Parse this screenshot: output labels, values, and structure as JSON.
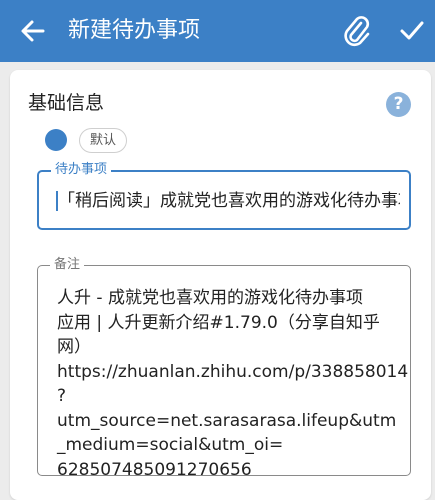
{
  "appbar": {
    "title": "新建待办事项",
    "color": "#3c80c6"
  },
  "form": {
    "section_title": "基础信息",
    "help_icon_glyph": "?",
    "color_dot": "#3c80c6",
    "category_chip": "默认",
    "todo_field": {
      "label": "待办事项",
      "value": "「稍后阅读」成就党也喜欢用的游戏化待办事项"
    },
    "note_field": {
      "label": "备注",
      "value": "人升 - 成就党也喜欢用的游戏化待办事项\n应用 | 人升更新介绍#1.79.0（分享自知乎\n网）\nhttps://zhuanlan.zhihu.com/p/338858014\n?utm_source=net.sarasarasa.lifeup&utm\n_medium=social&utm_oi=\n628507485091270656"
    }
  }
}
